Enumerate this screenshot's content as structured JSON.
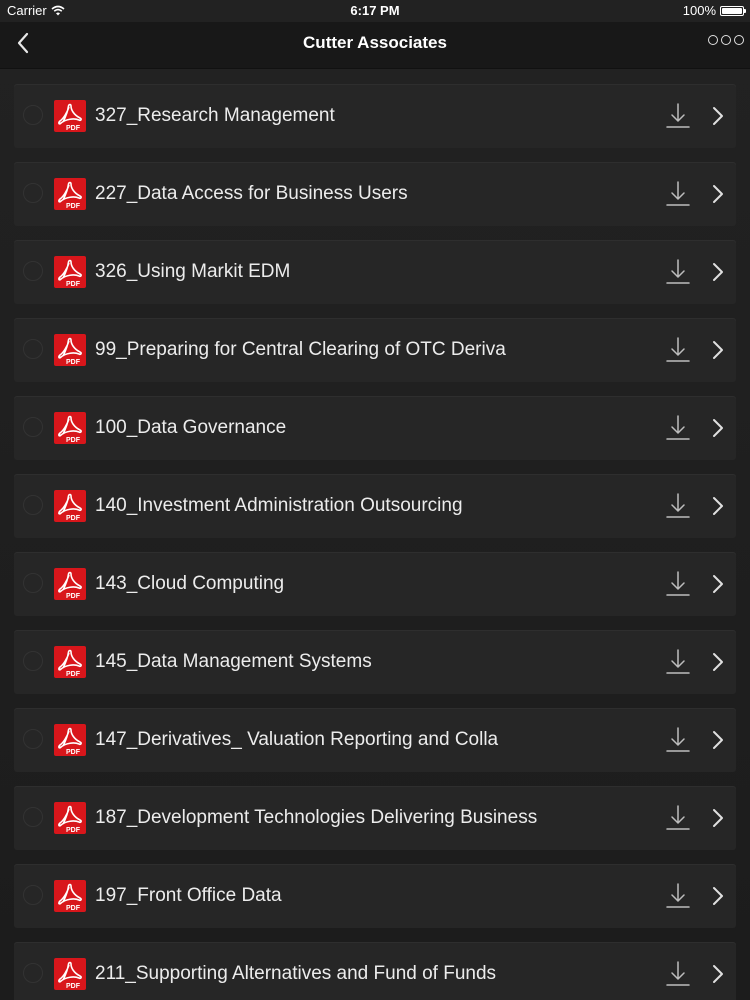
{
  "status_bar": {
    "carrier": "Carrier",
    "time": "6:17 PM",
    "battery": "100%",
    "battery_level": 1.0
  },
  "nav": {
    "title": "Cutter Associates",
    "back_icon": "chevron-left-icon",
    "more_icon": "more-options-icon"
  },
  "colors": {
    "background": "#1b1b1b",
    "row_background": "#262626",
    "pdf_red": "#d8161b",
    "text": "#ececec"
  },
  "documents": [
    {
      "title": "327_Research Management",
      "type": "PDF"
    },
    {
      "title": "227_Data Access for Business Users",
      "type": "PDF"
    },
    {
      "title": "326_Using Markit EDM",
      "type": "PDF"
    },
    {
      "title": "99_Preparing for Central Clearing of OTC Deriva",
      "type": "PDF"
    },
    {
      "title": "100_Data Governance",
      "type": "PDF"
    },
    {
      "title": "140_Investment Administration Outsourcing",
      "type": "PDF"
    },
    {
      "title": "143_Cloud Computing",
      "type": "PDF"
    },
    {
      "title": "145_Data Management Systems",
      "type": "PDF"
    },
    {
      "title": "147_Derivatives_ Valuation Reporting and Colla",
      "type": "PDF"
    },
    {
      "title": "187_Development Technologies Delivering Business",
      "type": "PDF"
    },
    {
      "title": "197_Front Office Data",
      "type": "PDF"
    },
    {
      "title": "211_Supporting Alternatives and Fund of Funds",
      "type": "PDF"
    }
  ]
}
